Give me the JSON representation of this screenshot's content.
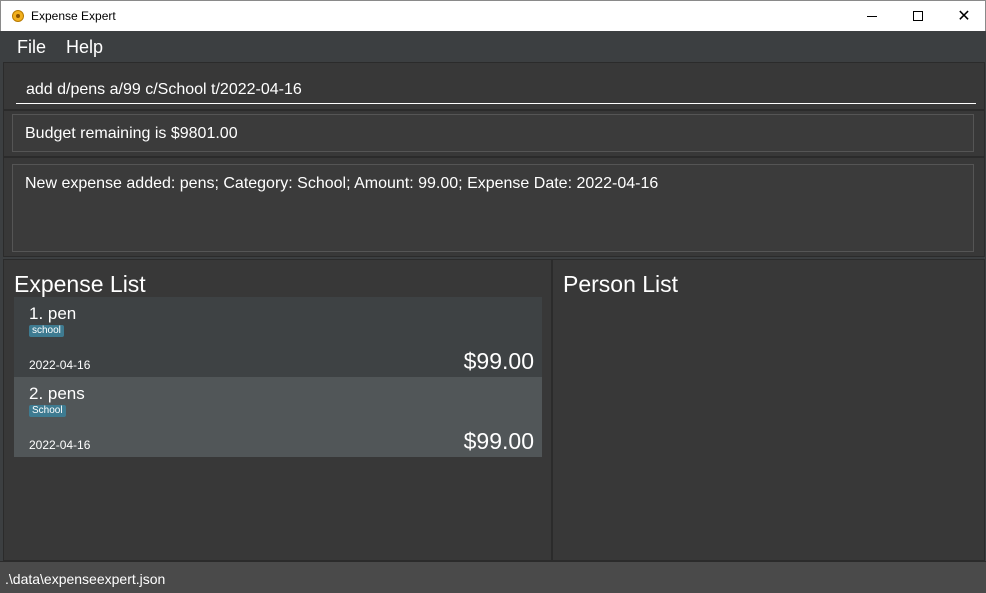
{
  "window": {
    "title": "Expense Expert",
    "minimize_glyph": "minimize",
    "maximize_glyph": "maximize",
    "close_glyph": "✕"
  },
  "menu": {
    "file_label": "File",
    "help_label": "Help"
  },
  "command": {
    "value": "add d/pens a/99 c/School t/2022-04-16"
  },
  "budget": {
    "text": "Budget remaining is $9801.00"
  },
  "result": {
    "text": "New expense added: pens; Category: School; Amount: 99.00; Expense Date: 2022-04-16"
  },
  "expense_list": {
    "title": "Expense List",
    "items": [
      {
        "name": "1.  pen",
        "tag": "school",
        "date": "2022-04-16",
        "amount": "$99.00"
      },
      {
        "name": "2.  pens",
        "tag": "School",
        "date": "2022-04-16",
        "amount": "$99.00"
      }
    ]
  },
  "person_list": {
    "title": "Person List"
  },
  "status": {
    "path": ".\\data\\expenseexpert.json"
  },
  "colors": {
    "background": "#3c3f41",
    "tag": "#3e7b91",
    "selected_card": "#515658"
  },
  "icons": {
    "app": "expense-expert-app-icon"
  }
}
